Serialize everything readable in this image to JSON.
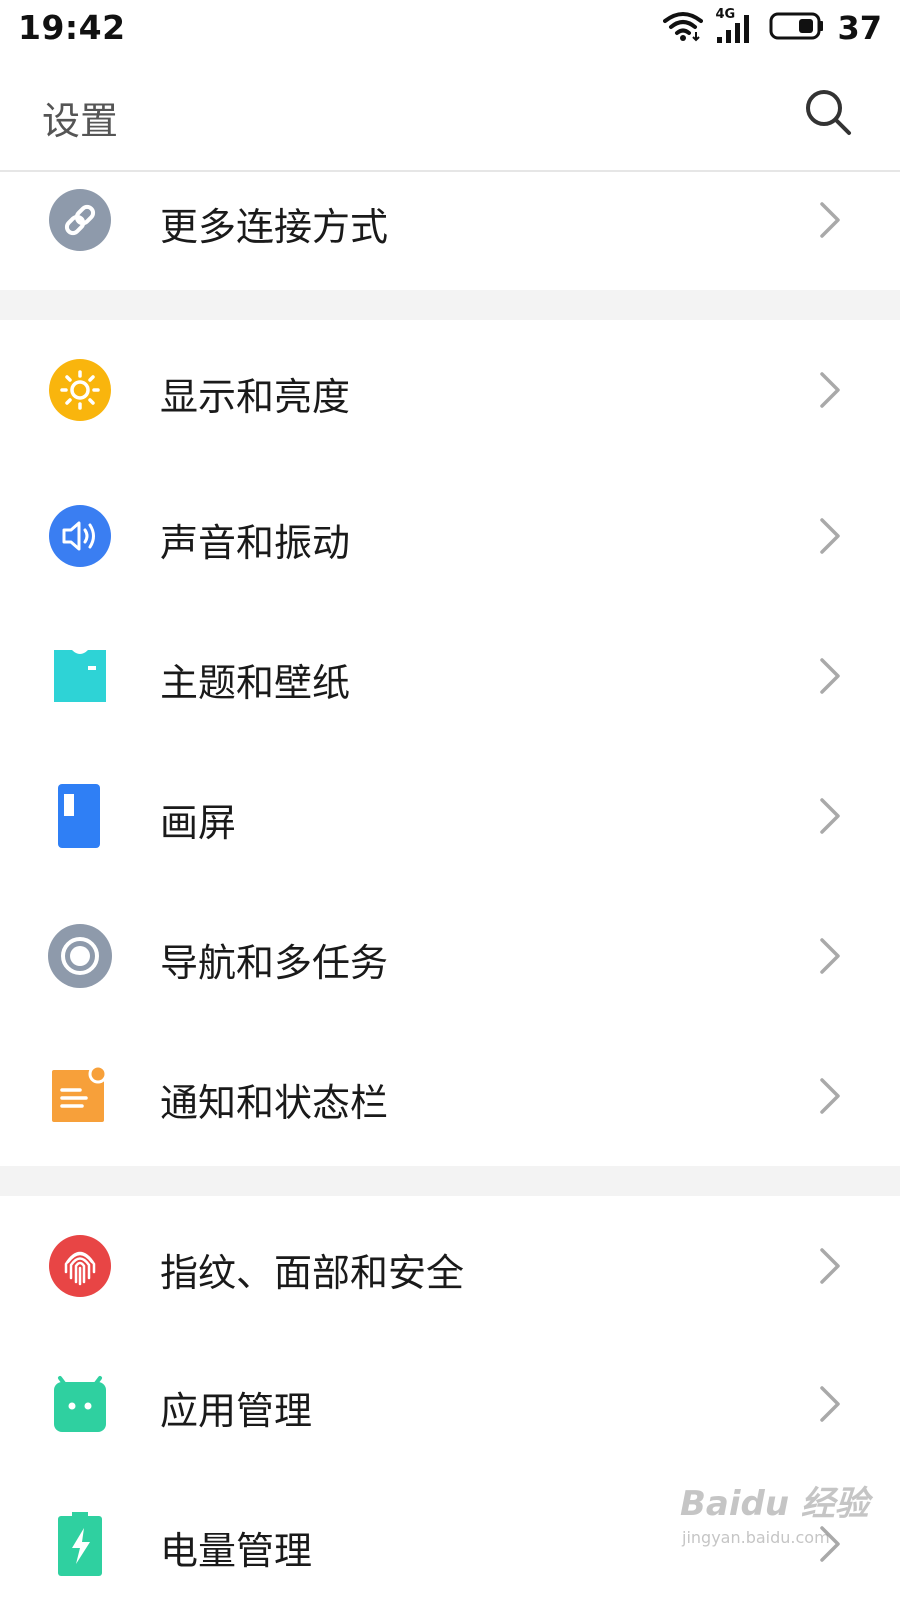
{
  "status_bar": {
    "time": "19:42",
    "network_type": "4G",
    "battery_level": "37",
    "icons": [
      "wifi-icon",
      "signal-icon",
      "battery-icon"
    ]
  },
  "header": {
    "title": "设置",
    "search_icon": "search-icon"
  },
  "sections": [
    {
      "items": [
        {
          "label": "更多连接方式",
          "icon": "link-icon",
          "icon_color": "#8e9aab"
        }
      ]
    },
    {
      "items": [
        {
          "label": "显示和亮度",
          "icon": "sun-icon",
          "icon_color": "#f9b50d"
        },
        {
          "label": "声音和振动",
          "icon": "speaker-icon",
          "icon_color": "#3a7ef2"
        },
        {
          "label": "主题和壁纸",
          "icon": "shirt-icon",
          "icon_color": "#2ed3d6"
        },
        {
          "label": "画屏",
          "icon": "screen-icon",
          "icon_color": "#2f7ff5"
        },
        {
          "label": "导航和多任务",
          "icon": "navigation-ring-icon",
          "icon_color": "#8e9aab"
        },
        {
          "label": "通知和状态栏",
          "icon": "notification-icon",
          "icon_color": "#f7a03a"
        }
      ]
    },
    {
      "items": [
        {
          "label": "指纹、面部和安全",
          "icon": "fingerprint-icon",
          "icon_color": "#e84545"
        },
        {
          "label": "应用管理",
          "icon": "android-icon",
          "icon_color": "#2fd0a0"
        },
        {
          "label": "电量管理",
          "icon": "battery-bolt-icon",
          "icon_color": "#2fd0a0"
        }
      ]
    }
  ],
  "watermark": {
    "main": "Baidu 经验",
    "sub": "jingyan.baidu.com"
  }
}
